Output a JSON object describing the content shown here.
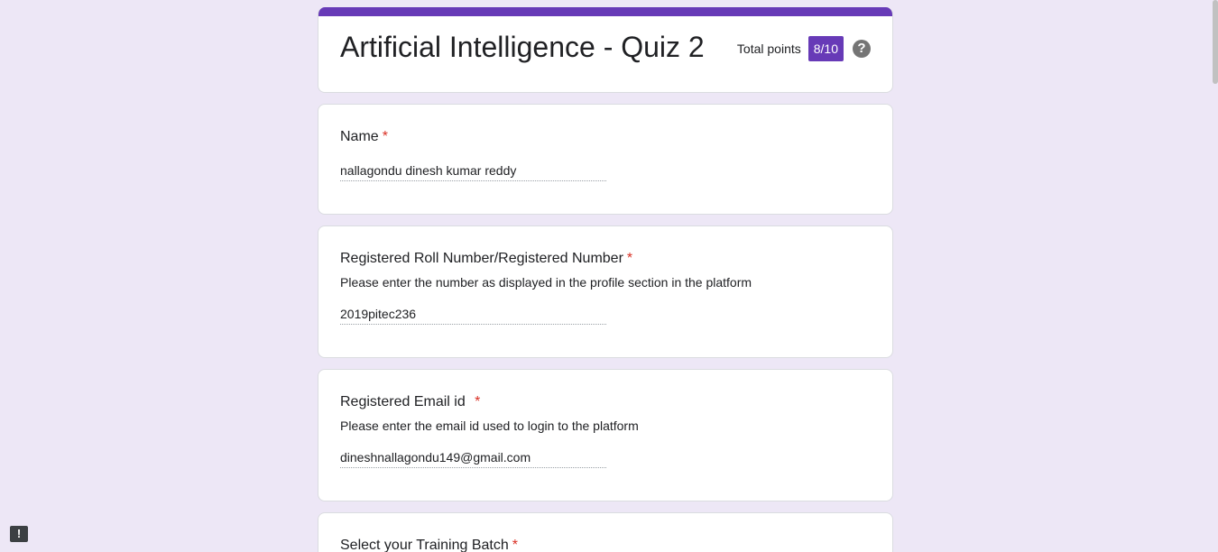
{
  "form": {
    "title": "Artificial Intelligence - Quiz 2",
    "total_points_label": "Total points",
    "score": "8/10"
  },
  "questions": [
    {
      "title": "Name",
      "required_mark": "*",
      "description": "",
      "answer": "nallagondu dinesh kumar reddy"
    },
    {
      "title": "Registered Roll Number/Registered Number",
      "required_mark": "*",
      "description": "Please enter the number as displayed in the profile section in the platform",
      "answer": "2019pitec236"
    },
    {
      "title": "Registered Email id ",
      "required_mark": "*",
      "description": "Please enter the email id used to login to the platform",
      "answer": "dineshnallagondu149@gmail.com"
    },
    {
      "title": "Select your Training Batch",
      "required_mark": "*"
    }
  ],
  "icons": {
    "help": "?",
    "feedback": "!"
  },
  "colors": {
    "accent": "#673ab7",
    "background": "#ede7f6",
    "required": "#d93025"
  }
}
